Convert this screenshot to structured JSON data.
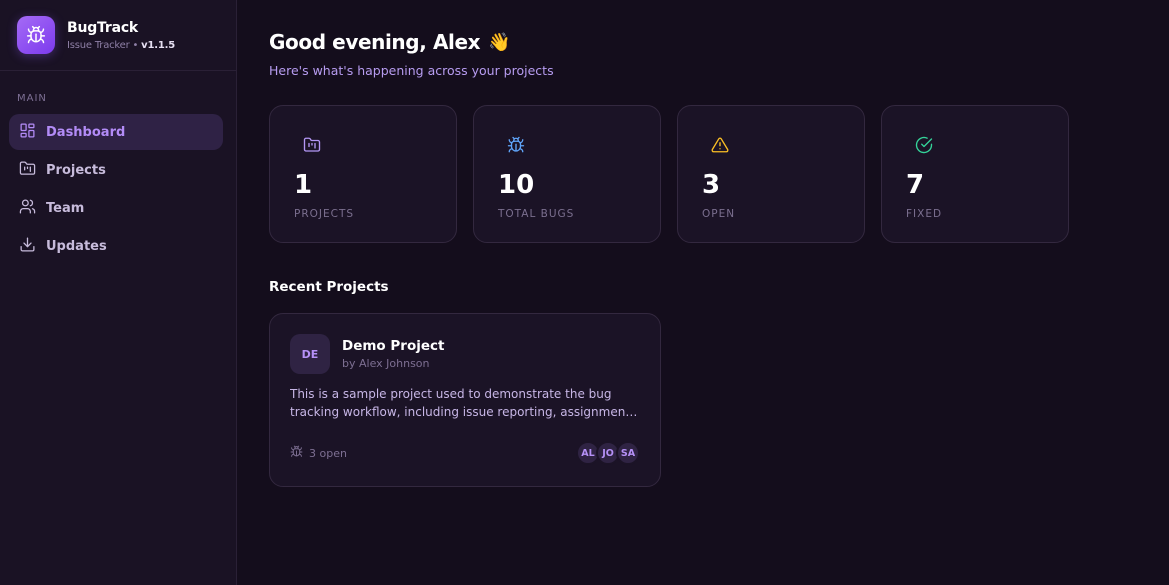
{
  "brand": {
    "name": "BugTrack",
    "subtitle": "Issue Tracker",
    "separator": " • ",
    "version": "v1.1.5",
    "logo_icon": "bug-icon"
  },
  "sidebar": {
    "section_label": "MAIN",
    "items": [
      {
        "label": "Dashboard",
        "icon": "dashboard-icon",
        "active": true
      },
      {
        "label": "Projects",
        "icon": "folder-icon",
        "active": false
      },
      {
        "label": "Team",
        "icon": "users-icon",
        "active": false
      },
      {
        "label": "Updates",
        "icon": "download-icon",
        "active": false
      }
    ]
  },
  "header": {
    "greeting": "Good evening, Alex",
    "wave": "👋",
    "subtitle": "Here's what's happening across your projects"
  },
  "stats": [
    {
      "value": "1",
      "label": "PROJECTS",
      "icon": "folder-kanban-icon",
      "color": "#b497f5"
    },
    {
      "value": "10",
      "label": "TOTAL BUGS",
      "icon": "bug-icon",
      "color": "#60a5fa"
    },
    {
      "value": "3",
      "label": "OPEN",
      "icon": "warning-icon",
      "color": "#fbbf24"
    },
    {
      "value": "7",
      "label": "FIXED",
      "icon": "check-circle-icon",
      "color": "#34d399"
    }
  ],
  "recent": {
    "title": "Recent Projects",
    "projects": [
      {
        "initials": "DE",
        "name": "Demo Project",
        "owner": "by Alex Johnson",
        "description": "This is a sample project used to demonstrate the bug tracking workflow, including issue reporting, assignment, and resolution tracking.",
        "open_label": "3 open",
        "members": [
          "AL",
          "JO",
          "SA"
        ]
      }
    ]
  },
  "colors": {
    "accent": "#8b5cf6",
    "background": "#140d1c",
    "sidebar": "#1a1224",
    "card": "#1b1326"
  }
}
